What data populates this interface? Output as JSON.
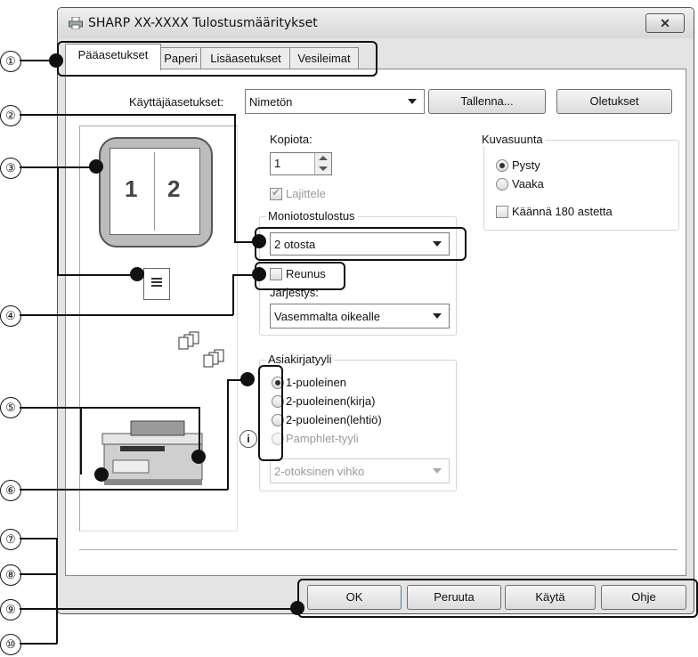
{
  "window": {
    "title": "SHARP XX-XXXX Tulostusmääritykset",
    "close_symbol": "✕"
  },
  "tabs": [
    "Pääasetukset",
    "Paperi",
    "Lisäasetukset",
    "Vesileimat"
  ],
  "user_settings": {
    "label": "Käyttäjäasetukset:",
    "value": "Nimetön",
    "save_button": "Tallenna...",
    "defaults_button": "Oletukset"
  },
  "preview": {
    "page_numbers": [
      "1",
      "2"
    ]
  },
  "copies": {
    "label": "Kopiota:",
    "value": "1"
  },
  "collate": {
    "label": "Lajittele",
    "checked": true,
    "disabled": true
  },
  "n_up": {
    "legend": "Moniotostulostus",
    "value": "2 otosta",
    "border_label": "Reunus",
    "border_checked": false,
    "order_label": "Järjestys:",
    "order_value": "Vasemmalta oikealle"
  },
  "orientation": {
    "legend": "Kuvasuunta",
    "options": [
      "Pysty",
      "Vaaka"
    ],
    "selected": "Pysty",
    "rotate_label": "Käännä 180 astetta"
  },
  "document_style": {
    "legend": "Asiakirjatyyli",
    "options": [
      "1-puoleinen",
      "2-puoleinen(kirja)",
      "2-puoleinen(lehtiö)",
      "Pamphlet-tyyli"
    ],
    "selected": "1-puoleinen",
    "booklet_value": "2-otoksinen vihko",
    "info_icon_text": "i"
  },
  "buttons": {
    "ok": "OK",
    "cancel": "Peruuta",
    "apply": "Käytä",
    "help": "Ohje"
  },
  "callouts": [
    "①",
    "②",
    "③",
    "④",
    "⑤",
    "⑥",
    "⑦",
    "⑧",
    "⑨",
    "⑩"
  ]
}
